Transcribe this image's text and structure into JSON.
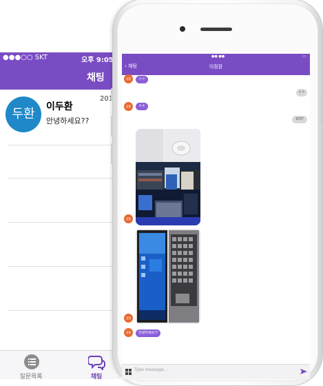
{
  "back_phone": {
    "status_bar": {
      "carrier": "●●●○○ SKT",
      "time": "오후 9:05"
    },
    "header": {
      "title": "채팅"
    },
    "chat_list": [
      {
        "avatar_text": "두환",
        "name": "이두환",
        "last_message": "안녕하세요??",
        "date": "201"
      }
    ],
    "tab_bar": [
      {
        "label": "질문목록",
        "icon": "list-icon",
        "active": false
      },
      {
        "label": "채팅",
        "icon": "chat-bubbles-icon",
        "active": true
      }
    ]
  },
  "front_phone": {
    "header": {
      "back_label": "채팅",
      "title": "이정환"
    },
    "messages": [
      {
        "side": "in",
        "text": "ㅇㅇ",
        "avatar": "정환"
      },
      {
        "side": "out",
        "text": "ㅇㅇ"
      },
      {
        "side": "in",
        "text": "ㅎㅎ",
        "avatar": "정환"
      },
      {
        "side": "out",
        "text": "보여?"
      },
      {
        "side": "in",
        "type": "photo",
        "subject": "desk",
        "avatar": "정환"
      },
      {
        "side": "in",
        "type": "photo",
        "subject": "laptop",
        "avatar": "정환"
      },
      {
        "side": "in",
        "text": "안녕하세요??",
        "avatar": "정환"
      }
    ],
    "input": {
      "placeholder": "Type message..."
    }
  },
  "colors": {
    "accent": "#7a4cc4",
    "avatar_blue": "#1e88c8",
    "avatar_orange": "#e9682f",
    "bubble_in": "#8a5fd8",
    "bubble_out": "#d9d9d9"
  }
}
